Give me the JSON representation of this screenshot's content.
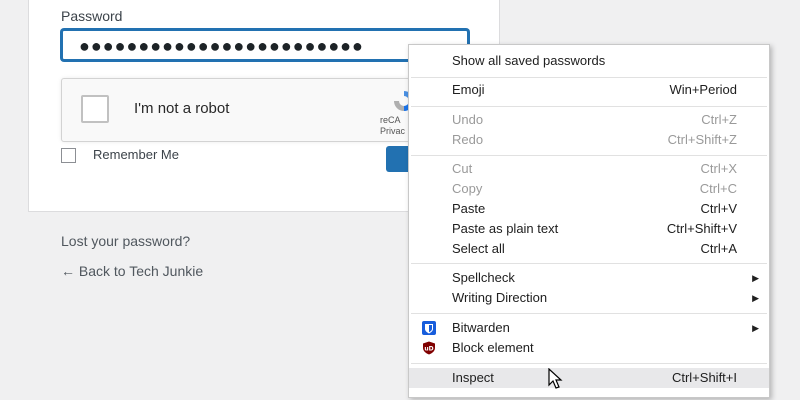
{
  "login": {
    "password_label": "Password",
    "password_value": "●●●●●●●●●●●●●●●●●●●●●●●●",
    "recaptcha_text": "I'm not a robot",
    "recaptcha_brand_1": "reCA",
    "recaptcha_brand_2": "Privac",
    "remember_label": "Remember Me",
    "lost_password": "Lost your password?",
    "back_link": "← Back to Tech Junkie"
  },
  "context_menu": {
    "show_saved": "Show all saved passwords",
    "emoji": {
      "label": "Emoji",
      "shortcut": "Win+Period"
    },
    "undo": {
      "label": "Undo",
      "shortcut": "Ctrl+Z"
    },
    "redo": {
      "label": "Redo",
      "shortcut": "Ctrl+Shift+Z"
    },
    "cut": {
      "label": "Cut",
      "shortcut": "Ctrl+X"
    },
    "copy": {
      "label": "Copy",
      "shortcut": "Ctrl+C"
    },
    "paste": {
      "label": "Paste",
      "shortcut": "Ctrl+V"
    },
    "paste_plain": {
      "label": "Paste as plain text",
      "shortcut": "Ctrl+Shift+V"
    },
    "select_all": {
      "label": "Select all",
      "shortcut": "Ctrl+A"
    },
    "spellcheck": "Spellcheck",
    "writing_direction": "Writing Direction",
    "bitwarden": "Bitwarden",
    "block_element": "Block element",
    "ublock_badge": "uD",
    "inspect": {
      "label": "Inspect",
      "shortcut": "Ctrl+Shift+I"
    }
  },
  "colors": {
    "accent": "#2271b1",
    "bitwarden": "#175ddc",
    "ublock": "#800000"
  }
}
